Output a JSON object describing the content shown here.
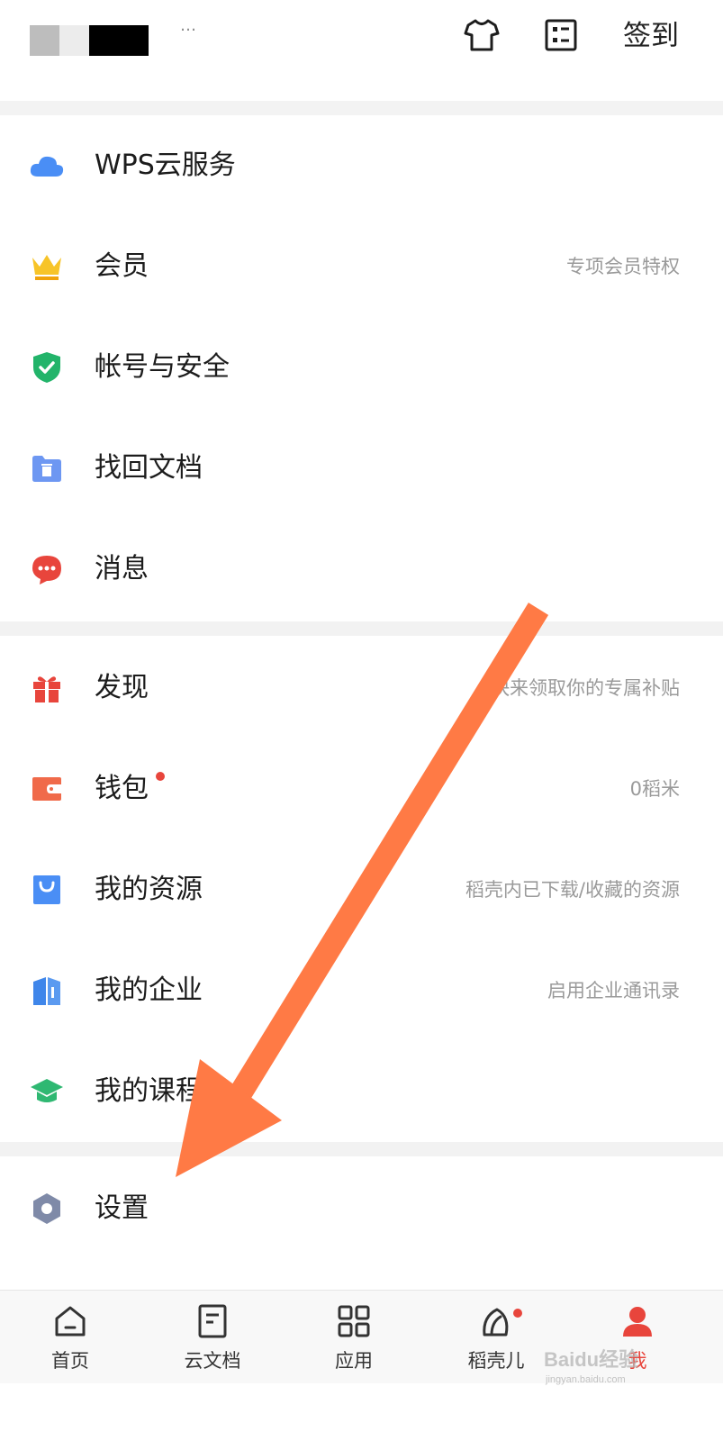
{
  "header": {
    "username": "…",
    "shirt_icon": "tshirt-icon",
    "card_icon": "checklist-card-icon",
    "signin_label": "签到"
  },
  "menu": [
    {
      "key": "cloud",
      "label": "WPS云服务",
      "sub": "",
      "icon": "cloud-icon",
      "icon_color": "#4a8ef5"
    },
    {
      "key": "vip",
      "label": "会员",
      "sub": "专项会员特权",
      "icon": "crown-icon",
      "icon_color": "#f7c428"
    },
    {
      "key": "account",
      "label": "帐号与安全",
      "sub": "",
      "icon": "shield-check-icon",
      "icon_color": "#22b46a"
    },
    {
      "key": "recover",
      "label": "找回文档",
      "sub": "",
      "icon": "folder-trash-icon",
      "icon_color": "#6d97f2"
    },
    {
      "key": "message",
      "label": "消息",
      "sub": "",
      "icon": "chat-bubble-icon",
      "icon_color": "#e8453c"
    },
    {
      "key": "discover",
      "label": "发现",
      "sub": "快来领取你的专属补贴",
      "icon": "gift-icon",
      "icon_color": "#e8453c"
    },
    {
      "key": "wallet",
      "label": "钱包",
      "sub": "0稻米",
      "icon": "wallet-icon",
      "icon_color": "#f06a4a"
    },
    {
      "key": "resources",
      "label": "我的资源",
      "sub": "稻壳内已下载/收藏的资源",
      "icon": "shopping-bag-icon",
      "icon_color": "#4a8ef5"
    },
    {
      "key": "enterprise",
      "label": "我的企业",
      "sub": "启用企业通讯录",
      "icon": "building-icon",
      "icon_color": "#3f86ea"
    },
    {
      "key": "courses",
      "label": "我的课程",
      "sub": "",
      "icon": "graduation-cap-icon",
      "icon_color": "#2fb872"
    },
    {
      "key": "settings",
      "label": "设置",
      "sub": "",
      "icon": "hexagon-settings-icon",
      "icon_color": "#7f8aa8"
    }
  ],
  "bottom_nav": [
    {
      "label": "首页",
      "icon": "home-icon"
    },
    {
      "label": "云文档",
      "icon": "document-icon"
    },
    {
      "label": "应用",
      "icon": "grid-apps-icon"
    },
    {
      "label": "稻壳儿",
      "icon": "leaf-icon"
    },
    {
      "label": "我",
      "icon": "person-icon"
    }
  ],
  "watermark": {
    "text": "Baidu经验",
    "sub": "jingyan.baidu.com"
  },
  "colors": {
    "accent": "#e8453c",
    "arrow": "#ff7a45"
  }
}
